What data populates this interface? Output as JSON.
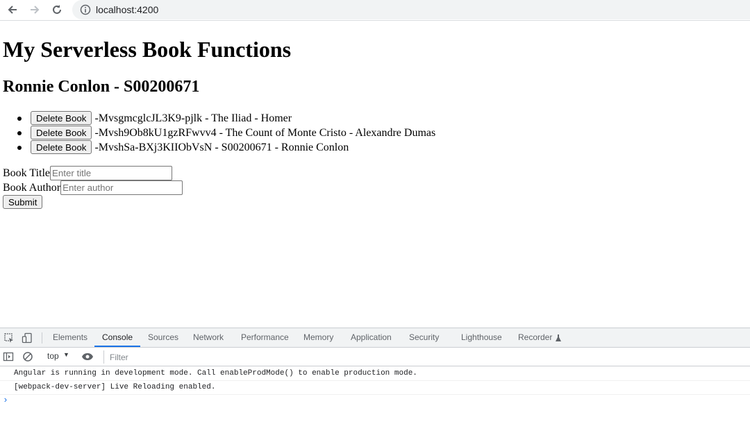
{
  "browser": {
    "url": "localhost:4200"
  },
  "page": {
    "title": "My Serverless Book Functions",
    "subtitle": "Ronnie Conlon - S00200671",
    "delete_label": "Delete Book",
    "books": [
      {
        "text": "-MvsgmcglcJL3K9-pjlk - The Iliad - Homer"
      },
      {
        "text": "-Mvsh9Ob8kU1gzRFwvv4 - The Count of Monte Cristo - Alexandre Dumas"
      },
      {
        "text": "-MvshSa-BXj3KIIObVsN - S00200671 - Ronnie Conlon"
      }
    ],
    "form": {
      "title_label": "Book Title",
      "title_placeholder": "Enter title",
      "author_label": "Book Author",
      "author_placeholder": "Enter author",
      "submit_label": "Submit"
    }
  },
  "devtools": {
    "tabs": [
      "Elements",
      "Console",
      "Sources",
      "Network",
      "Performance",
      "Memory",
      "Application",
      "Security",
      "Lighthouse",
      "Recorder"
    ],
    "active_tab": "Console",
    "context": "top",
    "filter_placeholder": "Filter",
    "messages": [
      "Angular is running in development mode. Call enableProdMode() to enable production mode.",
      "[webpack-dev-server] Live Reloading enabled."
    ],
    "accent_color": "#1a73e8"
  }
}
